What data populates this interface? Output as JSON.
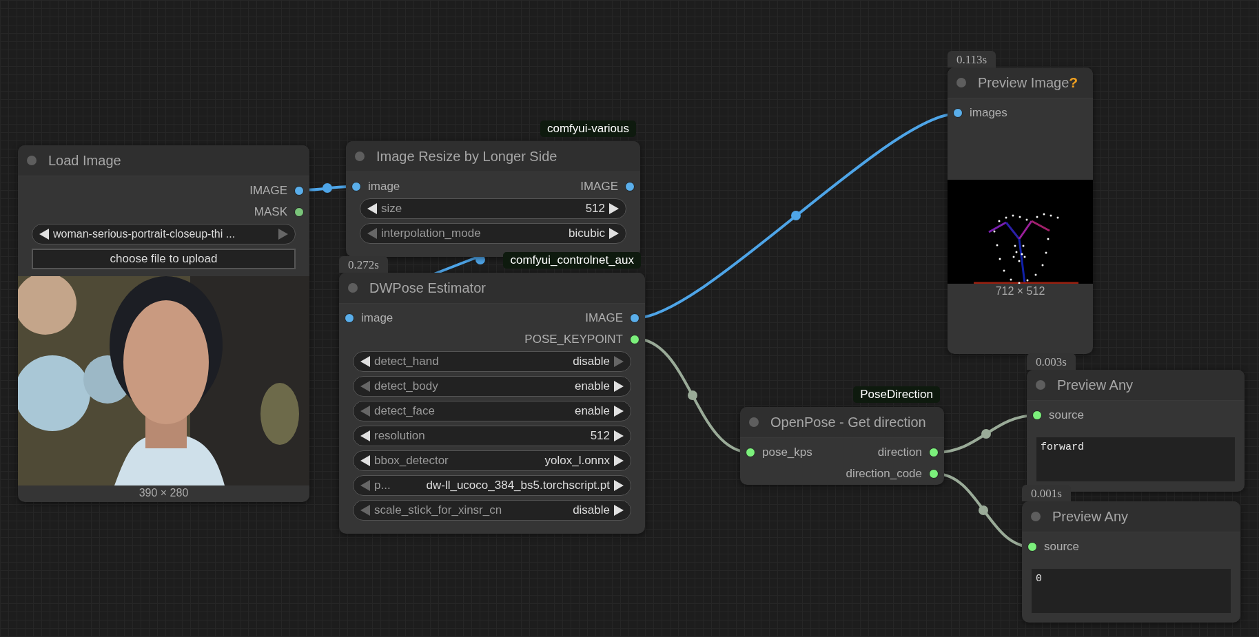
{
  "nodes": [
    {
      "kind": "load_image",
      "title": "Load Image",
      "outputs": [
        {
          "label": "IMAGE",
          "color": "#5aaeea"
        },
        {
          "label": "MASK",
          "color": "#7ac47a"
        }
      ],
      "widgets": [
        {
          "value": "woman-serious-portrait-closeup-thi ...",
          "prev_disabled": false,
          "next_disabled": true
        }
      ],
      "button": "choose file to upload",
      "caption": "390 × 280"
    },
    {
      "kind": "widgets",
      "title": "Image Resize by Longer Side",
      "source": "comfyui-various",
      "inputs": [
        {
          "label": "image",
          "color": "#5aaeea"
        }
      ],
      "outputs": [
        {
          "label": "IMAGE",
          "color": "#5aaeea"
        }
      ],
      "widgets": [
        {
          "label": "size",
          "value": "512",
          "prev_disabled": false,
          "next_disabled": false
        },
        {
          "label": "interpolation_mode",
          "value": "bicubic",
          "prev_disabled": true,
          "next_disabled": false
        }
      ]
    },
    {
      "kind": "widgets",
      "title": "DWPose Estimator",
      "timing": "0.272s",
      "source": "comfyui_controlnet_aux",
      "inputs": [
        {
          "label": "image",
          "color": "#5aaeea"
        }
      ],
      "outputs": [
        {
          "label": "IMAGE",
          "color": "#5aaeea"
        },
        {
          "label": "POSE_KEYPOINT",
          "color": "#7cf07c"
        }
      ],
      "widgets": [
        {
          "label": "detect_hand",
          "value": "disable",
          "prev_disabled": false,
          "next_disabled": true
        },
        {
          "label": "detect_body",
          "value": "enable",
          "prev_disabled": true,
          "next_disabled": false
        },
        {
          "label": "detect_face",
          "value": "enable",
          "prev_disabled": true,
          "next_disabled": false
        },
        {
          "label": "resolution",
          "value": "512",
          "prev_disabled": false,
          "next_disabled": false
        },
        {
          "label": "bbox_detector",
          "value": "yolox_l.onnx",
          "prev_disabled": false,
          "next_disabled": false
        },
        {
          "label": "p...",
          "value": "dw-ll_ucoco_384_bs5.torchscript.pt",
          "prev_disabled": true,
          "next_disabled": false
        },
        {
          "label": "scale_stick_for_xinsr_cn",
          "value": "disable",
          "prev_disabled": true,
          "next_disabled": false
        }
      ]
    },
    {
      "kind": "preview_image",
      "title": "Preview Image",
      "help": "?",
      "timing": "0.113s",
      "inputs": [
        {
          "label": "images",
          "color": "#5aaeea"
        }
      ],
      "caption": "712 × 512"
    },
    {
      "kind": "widgets",
      "title": "OpenPose - Get direction",
      "source": "PoseDirection",
      "inputs": [
        {
          "label": "pose_kps",
          "color": "#7cf07c"
        }
      ],
      "outputs": [
        {
          "label": "direction",
          "color": "#7cf07c"
        },
        {
          "label": "direction_code",
          "color": "#7cf07c"
        }
      ]
    },
    {
      "kind": "preview_any",
      "title": "Preview Any",
      "timing": "0.003s",
      "inputs": [
        {
          "label": "source",
          "color": "#7cf07c"
        }
      ],
      "text": "forward"
    },
    {
      "kind": "preview_any",
      "title": "Preview Any",
      "timing": "0.001s",
      "inputs": [
        {
          "label": "source",
          "color": "#7cf07c"
        }
      ],
      "text": "0"
    }
  ]
}
